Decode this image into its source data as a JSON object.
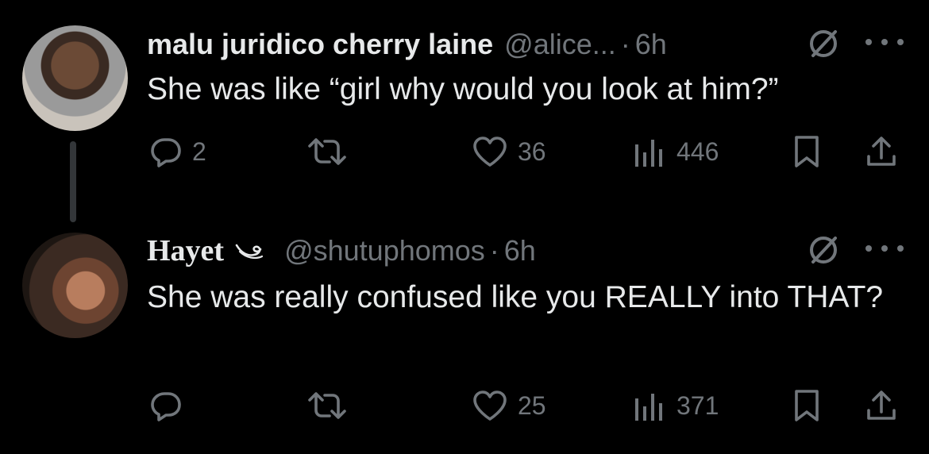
{
  "tweets": [
    {
      "display_name": "malu juridico cherry laine",
      "handle": "@alice...",
      "separator": "·",
      "time": "6h",
      "text": "She was like “girl why would you look at him?”",
      "replies": "2",
      "retweets": "",
      "likes": "36",
      "views": "446"
    },
    {
      "display_name": "Hayet",
      "handle": "@shutuphomos",
      "separator": "·",
      "time": "6h",
      "text": "She was really confused like you REALLY into THAT?",
      "replies": "",
      "retweets": "",
      "likes": "25",
      "views": "371"
    }
  ],
  "icons": {
    "reply": "reply-icon",
    "retweet": "retweet-icon",
    "like": "heart-icon",
    "views": "views-icon",
    "bookmark": "bookmark-icon",
    "share": "share-icon",
    "more": "more-icon",
    "grok": "slashed-circle-icon",
    "decoration": "swirl-icon"
  },
  "colors": {
    "background": "#000000",
    "text": "#e7e9ea",
    "secondary": "#71767b",
    "thread_line": "#333639"
  }
}
